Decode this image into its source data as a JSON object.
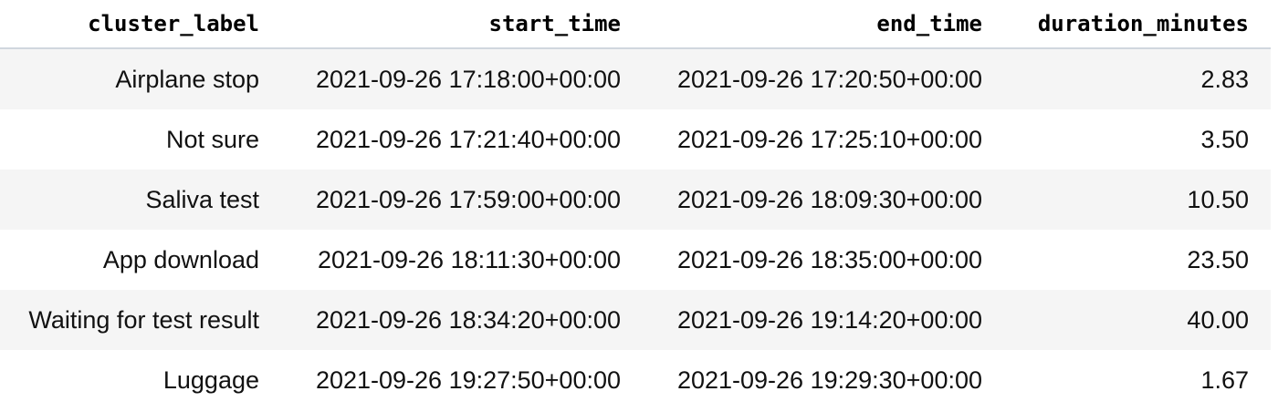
{
  "table": {
    "columns": [
      "cluster_label",
      "start_time",
      "end_time",
      "duration_minutes"
    ],
    "rows": [
      [
        "Airplane stop",
        "2021-09-26 17:18:00+00:00",
        "2021-09-26 17:20:50+00:00",
        "2.83"
      ],
      [
        "Not sure",
        "2021-09-26 17:21:40+00:00",
        "2021-09-26 17:25:10+00:00",
        "3.50"
      ],
      [
        "Saliva test",
        "2021-09-26 17:59:00+00:00",
        "2021-09-26 18:09:30+00:00",
        "10.50"
      ],
      [
        "App download",
        "2021-09-26 18:11:30+00:00",
        "2021-09-26 18:35:00+00:00",
        "23.50"
      ],
      [
        "Waiting for test result",
        "2021-09-26 18:34:20+00:00",
        "2021-09-26 19:14:20+00:00",
        "40.00"
      ],
      [
        "Luggage",
        "2021-09-26 19:27:50+00:00",
        "2021-09-26 19:29:30+00:00",
        "1.67"
      ]
    ]
  }
}
